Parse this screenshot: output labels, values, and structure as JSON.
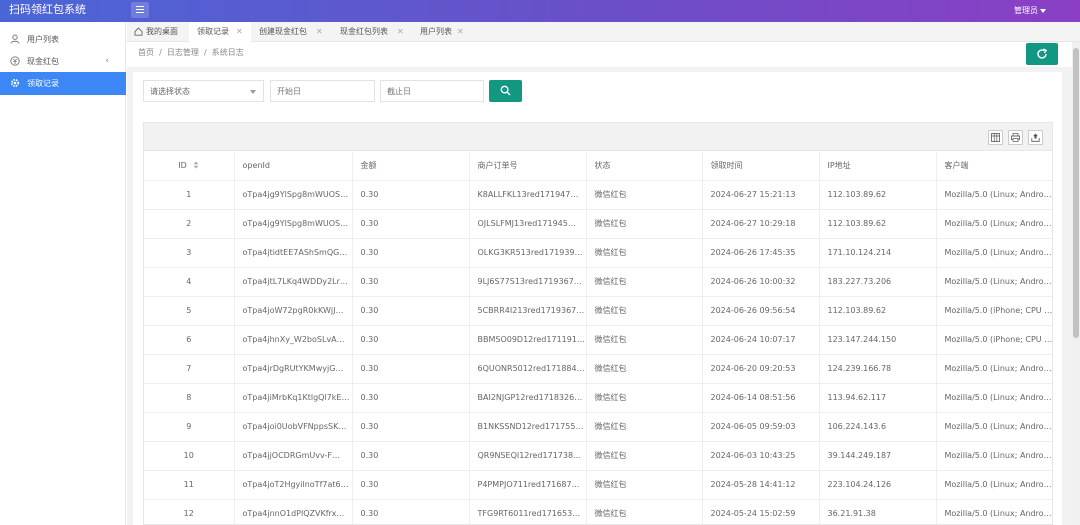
{
  "app": {
    "title": "扫码领红包系统",
    "user": "管理员"
  },
  "sidebar": {
    "items": [
      {
        "label": "用户列表"
      },
      {
        "label": "现金红包"
      },
      {
        "label": "领取记录"
      }
    ]
  },
  "tabs": [
    {
      "label": "我的桌面"
    },
    {
      "label": "领取记录"
    },
    {
      "label": "创建现金红包"
    },
    {
      "label": "现金红包列表"
    },
    {
      "label": "用户列表"
    }
  ],
  "breadcrumb": "首页  /  日志管理  /  系统日志",
  "filters": {
    "status_placeholder": "请选择状态",
    "start_placeholder": "开始日",
    "end_placeholder": "截止日"
  },
  "table": {
    "headers": [
      "ID",
      "openId",
      "金额",
      "商户订单号",
      "状态",
      "领取时间",
      "IP地址",
      "客户端"
    ],
    "rows": [
      [
        "1",
        "oTpa4jg9YlSpg8mWUOS…",
        "0.30",
        "K8ALLFKL13red171947…",
        "微信红包",
        "2024-06-27 15:21:13",
        "112.103.89.62",
        "Mozilla/5.0 (Linux; Androi…"
      ],
      [
        "2",
        "oTpa4jg9YlSpg8mWUOS…",
        "0.30",
        "OJLSLFMJ13red171945…",
        "微信红包",
        "2024-06-27 10:29:18",
        "112.103.89.62",
        "Mozilla/5.0 (Linux; Androi…"
      ],
      [
        "3",
        "oTpa4jtidtEE7AShSmQG…",
        "0.30",
        "OLKG3KR513red171939…",
        "微信红包",
        "2024-06-26 17:45:35",
        "171.10.124.214",
        "Mozilla/5.0 (Linux; Androi…"
      ],
      [
        "4",
        "oTpa4jtL7LKq4WDDy2Lr…",
        "0.30",
        "9LJ6S77S13red1719367…",
        "微信红包",
        "2024-06-26 10:00:32",
        "183.227.73.206",
        "Mozilla/5.0 (Linux; Androi…"
      ],
      [
        "5",
        "oTpa4joW72pgR0kKWjJ…",
        "0.30",
        "5CBRR4I213red1719367…",
        "微信红包",
        "2024-06-26 09:56:54",
        "112.103.89.62",
        "Mozilla/5.0 (iPhone; CPU …"
      ],
      [
        "6",
        "oTpa4jhnXy_W2boSLvA…",
        "0.30",
        "BBMSO09D12red171191…",
        "微信红包",
        "2024-06-24 10:07:17",
        "123.147.244.150",
        "Mozilla/5.0 (iPhone; CPU …"
      ],
      [
        "7",
        "oTpa4jrDgRUtYKMwyjG…",
        "0.30",
        "6QUONR5012red171884…",
        "微信红包",
        "2024-06-20 09:20:53",
        "124.239.166.78",
        "Mozilla/5.0 (Linux; Androi…"
      ],
      [
        "8",
        "oTpa4jiMrbKq1KtlgQl7kE…",
        "0.30",
        "BAI2NJGP12red1718326…",
        "微信红包",
        "2024-06-14 08:51:56",
        "113.94.62.117",
        "Mozilla/5.0 (Linux; Androi…"
      ],
      [
        "9",
        "oTpa4joi0UobVFNppsSK…",
        "0.30",
        "B1NKSSND12red171755…",
        "微信红包",
        "2024-06-05 09:59:03",
        "106.224.143.6",
        "Mozilla/5.0 (Linux; Androi…"
      ],
      [
        "10",
        "oTpa4jjOCDRGmUvv-F…",
        "0.30",
        "QR9NSEQI12red171738…",
        "微信红包",
        "2024-06-03 10:43:25",
        "39.144.249.187",
        "Mozilla/5.0 (Linux; Androi…"
      ],
      [
        "11",
        "oTpa4joT2HgyilnoTf7at6…",
        "0.30",
        "P4PMPJO711red171687…",
        "微信红包",
        "2024-05-28 14:41:12",
        "223.104.24.126",
        "Mozilla/5.0 (Linux; Androi…"
      ],
      [
        "12",
        "oTpa4jnnO1dPlQZVKfrx…",
        "0.30",
        "TFG9RT6011red171653…",
        "微信红包",
        "2024-05-24 15:02:59",
        "36.21.91.38",
        "Mozilla/5.0 (Linux; Androi…"
      ]
    ]
  },
  "icons": {
    "header": [
      "menu-icon",
      "caret-down-icon"
    ],
    "sidebar": [
      "user-icon",
      "money-icon",
      "gear-icon",
      "chevron-left-icon"
    ],
    "tabs": [
      "home-icon",
      "close-icon"
    ],
    "actions": [
      "refresh-icon",
      "search-icon",
      "columns-icon",
      "print-icon",
      "export-icon",
      "sort-icon"
    ]
  },
  "colors": {
    "header_start": "#4a66d6",
    "header_end": "#8a3fc4",
    "active_menu": "#3c87f5",
    "primary_button": "#129783"
  }
}
